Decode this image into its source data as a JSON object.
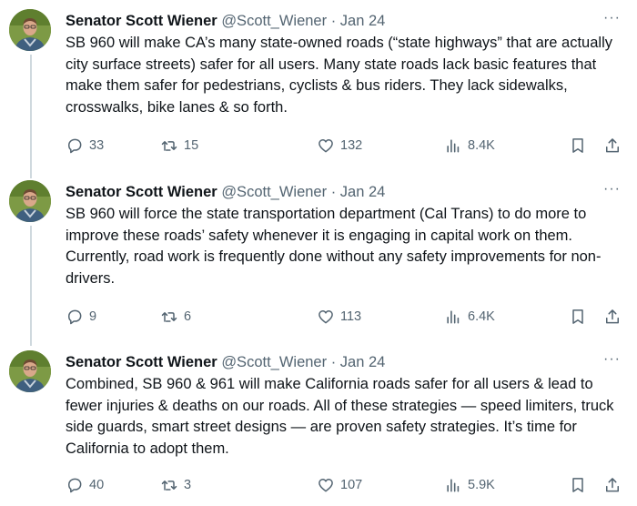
{
  "tweets": [
    {
      "name": "Senator Scott Wiener",
      "handle": "@Scott_Wiener",
      "sep": " · ",
      "date": "Jan 24",
      "more": "···",
      "text": "SB 960 will make CA’s many state-owned roads (“state highways” that are actually city surface streets) safer for all users. Many state roads lack basic features that make them safer for pedestrians, cyclists & bus riders. They lack sidewalks, crosswalks, bike lanes & so forth.",
      "replies": "33",
      "retweets": "15",
      "likes": "132",
      "views": "8.4K"
    },
    {
      "name": "Senator Scott Wiener",
      "handle": "@Scott_Wiener",
      "sep": " · ",
      "date": "Jan 24",
      "more": "···",
      "text": "SB 960 will force the state transportation department (Cal Trans) to do more to improve these roads’ safety whenever it is engaging in capital work on them. Currently, road work is frequently done without any safety improvements for non-drivers.",
      "replies": "9",
      "retweets": "6",
      "likes": "113",
      "views": "6.4K"
    },
    {
      "name": "Senator Scott Wiener",
      "handle": "@Scott_Wiener",
      "sep": " · ",
      "date": "Jan 24",
      "more": "···",
      "text": "Combined, SB 960 & 961 will make California roads safer for all users & lead to fewer injuries & deaths on our roads. All of these strategies — speed limiters, truck side guards, smart street designs — are proven safety strategies. It’s time for California to adopt them.",
      "replies": "40",
      "retweets": "3",
      "likes": "107",
      "views": "5.9K"
    }
  ],
  "icons": {
    "reply": "reply-icon",
    "retweet": "retweet-icon",
    "like": "heart-icon",
    "views": "views-icon",
    "bookmark": "bookmark-icon",
    "share": "share-icon",
    "more": "more-icon"
  },
  "colors": {
    "text": "#0f1419",
    "secondary": "#536471",
    "thread_line": "#cfd9de",
    "background": "#ffffff"
  }
}
